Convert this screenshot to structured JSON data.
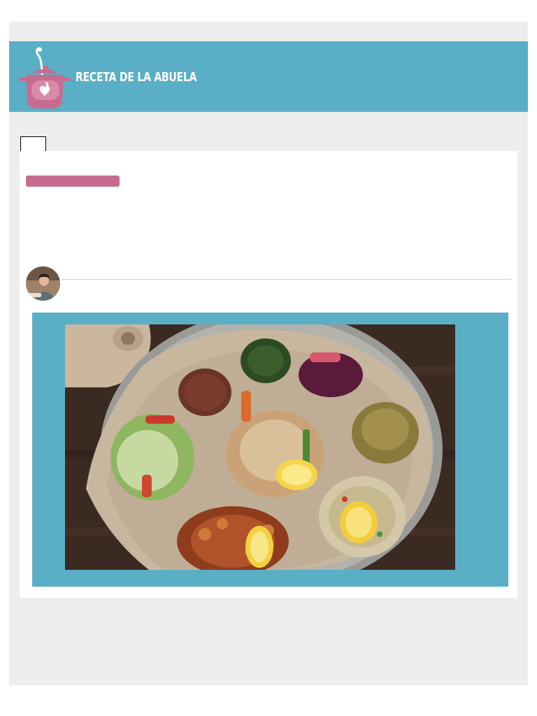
{
  "header": {
    "site_title": "RECETA DE LA ABUELA",
    "logo_icon": "cooking-pot-heart-icon",
    "background_color": "#5aafc6",
    "logo_color": "#c76c90"
  },
  "article": {
    "category_color": "#c76c90",
    "author_avatar": "author-avatar-photo",
    "hero_image": "ethiopian-injera-platter-photo",
    "hero_frame_color": "#5aafc6"
  }
}
